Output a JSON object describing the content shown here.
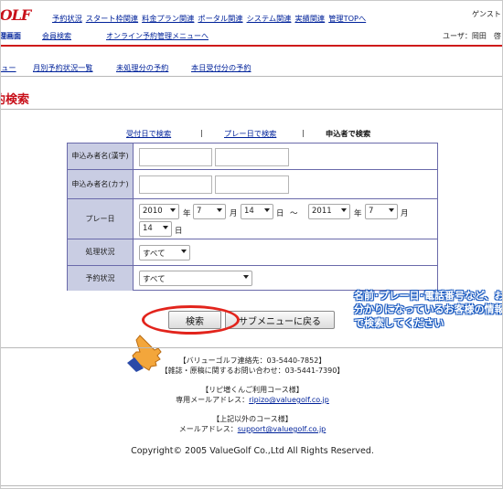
{
  "logo": "GOLF",
  "nav": [
    "予約状況",
    "スタート枠関連",
    "料金プラン関連",
    "ポータル関連",
    "システム関連",
    "実績関連",
    "管理TOPへ"
  ],
  "guest": "ゲンスト",
  "subnav": {
    "home": "理画面",
    "member": "会員検索",
    "online": "オンライン予約管理メニューへ",
    "user": "ユーザ：岡田　啓"
  },
  "subbar": [
    "ニュー",
    "月別予約状況一覧",
    "未処理分の予約",
    "本日受付分の予約"
  ],
  "title": "約検索",
  "searchby": {
    "accept": "受付日で検索",
    "sep": "|",
    "play": "プレー日で検索",
    "current": "申込者で検索"
  },
  "form": {
    "name_kanji": "申込み者名(漢字)",
    "name_kana": "申込み者名(カナ)",
    "play_date": {
      "label": "プレー日",
      "from_year": "2010",
      "from_month": "7",
      "from_day": "14",
      "to_year": "2011",
      "to_month": "7",
      "to_day": "14",
      "year": "年",
      "month": "月",
      "day": "日",
      "tilde": "～"
    },
    "status": {
      "label": "処理状況",
      "value": "すべて"
    },
    "reservation": {
      "label": "予約状況",
      "value": "すべて"
    }
  },
  "buttons": {
    "search": "検索",
    "back": "サブメニューに戻る"
  },
  "callout": "名前･プレー日･電話番号など、お分かりになっているお客様の情報で検索してください",
  "footer": {
    "l1": "【バリューゴルフ連絡先：03-5440-7852】",
    "l2": "【雑誌・原稿に関するお問い合わせ：03-5441-7390】",
    "l3": "【リピ増くんご利用コース様】",
    "l4_label": "専用メールアドレス：",
    "l4_email": "ripizo@valuegolf.co.jp",
    "l5": "【上記以外のコース様】",
    "l6_label": "メールアドレス：",
    "l6_email": "support@valuegolf.co.jp"
  },
  "copyright": "Copyright© 2005 ValueGolf Co.,Ltd All Rights Reserved.",
  "colors": {
    "accent": "#c8101a",
    "link": "#00229a",
    "label_bg": "#c9cde3",
    "border": "#6a6aaa",
    "callout": "#1a5ac0"
  }
}
